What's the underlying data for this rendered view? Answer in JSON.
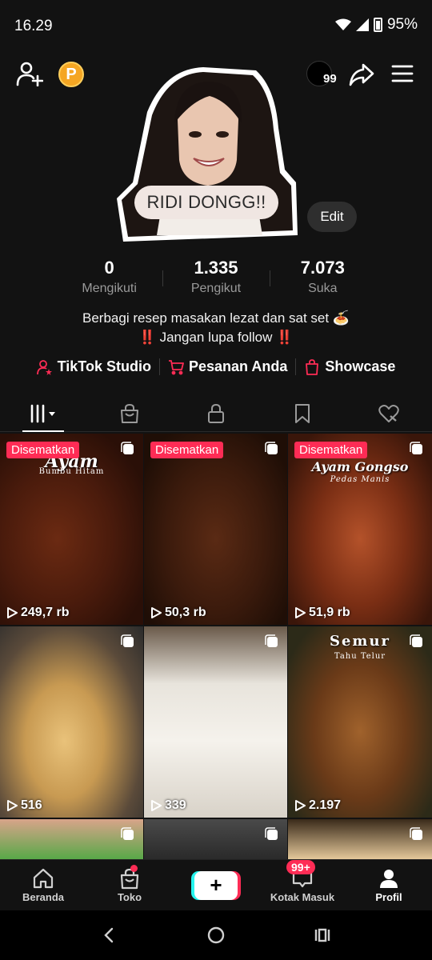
{
  "status_bar": {
    "time": "16.29",
    "battery": "95%"
  },
  "header": {
    "coin_label": "P",
    "story_count": "99"
  },
  "profile": {
    "sticker_text": "RIDI DONGG!!",
    "edit_label": "Edit",
    "stats": [
      {
        "value": "0",
        "label": "Mengikuti"
      },
      {
        "value": "1.335",
        "label": "Pengikut"
      },
      {
        "value": "7.073",
        "label": "Suka"
      }
    ],
    "bio_line1": "Berbagi resep masakan lezat dan sat set 🍝",
    "bio_line2": "‼️ Jangan lupa follow ‼️",
    "links": [
      {
        "label": "TikTok Studio",
        "icon": "person-star-icon"
      },
      {
        "label": "Pesanan Anda",
        "icon": "cart-icon"
      },
      {
        "label": "Showcase",
        "icon": "bag-icon"
      }
    ]
  },
  "tabs": [
    "videos-grid-icon",
    "shop-bag-icon",
    "lock-icon",
    "bookmark-icon",
    "liked-heart-icon"
  ],
  "grid": [
    {
      "pinned": "Disematkan",
      "views": "249,7 rb",
      "title": "Ayam",
      "subtitle": "Bumbu Hitam"
    },
    {
      "pinned": "Disematkan",
      "views": "50,3 rb"
    },
    {
      "pinned": "Disematkan",
      "views": "51,9 rb",
      "title": "Ayam Gongso",
      "subtitle": "Pedas Manis"
    },
    {
      "views": "516"
    },
    {
      "views": "339"
    },
    {
      "views": "2.197",
      "title": "Semur",
      "subtitle": "Tahu Telur"
    }
  ],
  "bottom_nav": {
    "home": "Beranda",
    "shop": "Toko",
    "create": "+",
    "inbox": "Kotak Masuk",
    "inbox_badge": "99+",
    "profile": "Profil"
  },
  "colors": {
    "accent": "#fe2c55",
    "cyan": "#25f4ee",
    "background": "#121212"
  }
}
